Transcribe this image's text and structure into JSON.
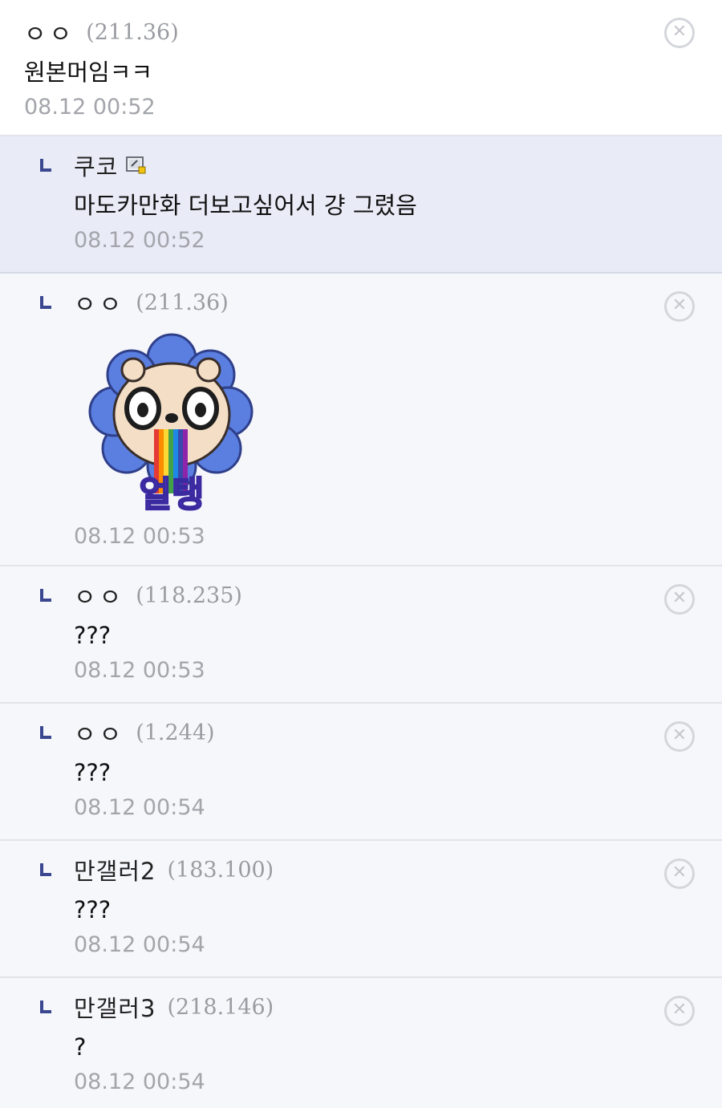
{
  "comments": [
    {
      "nick": "ㅇㅇ",
      "ip": "(211.36)",
      "text": "원본머임ㅋㅋ",
      "time": "08.12 00:52"
    },
    {
      "nick": "쿠코",
      "icon": "gallog-icon",
      "text": "마도카만화 더보고싶어서 걍 그렸음",
      "time": "08.12 00:52"
    },
    {
      "nick": "ㅇㅇ",
      "ip": "(211.36)",
      "sticker_label": "얼탱",
      "time": "08.12 00:53"
    },
    {
      "nick": "ㅇㅇ",
      "ip": "(118.235)",
      "text": "???",
      "time": "08.12 00:53"
    },
    {
      "nick": "ㅇㅇ",
      "ip": "(1.244)",
      "text": "???",
      "time": "08.12 00:54"
    },
    {
      "nick": "만갤러2",
      "ip": "(183.100)",
      "text": "???",
      "time": "08.12 00:54"
    },
    {
      "nick": "만갤러3",
      "ip": "(218.146)",
      "text": "?",
      "time": "08.12 00:54"
    }
  ],
  "delete_glyph": "✕",
  "colors": {
    "reply_arrow": "#3b4890",
    "highlight_bg": "#e9ecf7",
    "sticker_petal": "#5a7fe0",
    "sticker_text": "#6a4bd8"
  }
}
